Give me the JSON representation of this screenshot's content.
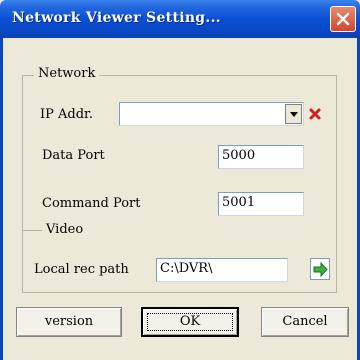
{
  "window": {
    "title": "Network Viewer Setting..."
  },
  "network": {
    "legend": "Network",
    "ip_label": "IP Addr.",
    "ip_value": "",
    "data_port_label": "Data Port",
    "data_port_value": "5000",
    "command_port_label": "Command Port",
    "command_port_value": "5001"
  },
  "video": {
    "legend": "Video",
    "local_rec_label": "Local rec path",
    "local_rec_value": "C:\\DVR\\"
  },
  "buttons": {
    "version": "version",
    "ok": "OK",
    "cancel": "Cancel"
  },
  "icons": {
    "close": "close-icon",
    "delete": "delete-x-icon",
    "dropdown": "chevron-down-icon",
    "browse": "green-arrow-icon"
  },
  "colors": {
    "titlebar": "#0a4fd4",
    "dialog_bg": "#ece9d8",
    "close": "#d2462a",
    "delete_icon": "#cc2222",
    "browse_icon": "#2e9a2e"
  }
}
